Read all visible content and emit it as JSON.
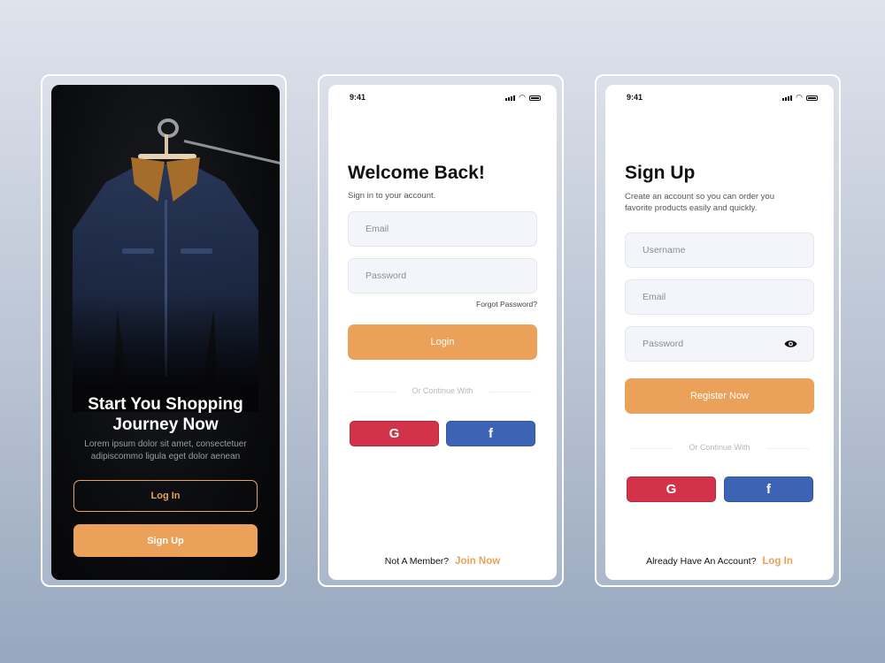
{
  "colors": {
    "accent": "#eba15a",
    "google": "#d23349",
    "facebook": "#3d64b4",
    "dark": "#0b0c0f"
  },
  "onboarding": {
    "title_line1": "Start You Shopping",
    "title_line2": "Journey Now",
    "body_line1": "Lorem ipsum dolor sit amet, consectetuer",
    "body_line2": "adipiscommo ligula eget dolor aenean",
    "login_label": "Log In",
    "signup_label": "Sign Up"
  },
  "login": {
    "status": {
      "time": "9:41"
    },
    "title": "Welcome Back!",
    "subtitle": "Sign in to your account.",
    "email_placeholder": "Email",
    "password_placeholder": "Password",
    "forgot": "Forgot Password?",
    "login_label": "Login",
    "or_continue": "Or Continue With",
    "google_icon": "G",
    "facebook_icon": "f",
    "footer_text": "Not A Member?",
    "footer_link": "Join Now"
  },
  "signup": {
    "status": {
      "time": "9:41"
    },
    "title": "Sign Up",
    "subtitle_line1": "Create an account so you can order you",
    "subtitle_line2": "favorite products easily and quickly.",
    "username_placeholder": "Username",
    "email_placeholder": "Email",
    "password_placeholder": "Password",
    "register_label": "Register Now",
    "or_continue": "Or Continue With",
    "google_icon": "G",
    "facebook_icon": "f",
    "footer_text": "Already Have An Account?",
    "footer_link": "Log In"
  }
}
